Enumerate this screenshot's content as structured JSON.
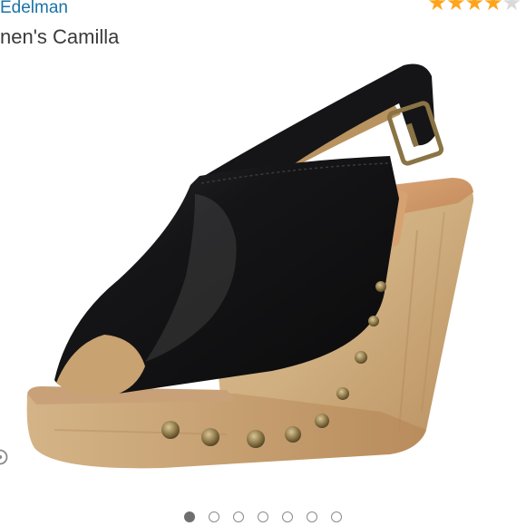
{
  "product": {
    "brand": "Edelman",
    "title": "nen's Camilla",
    "rating": 4,
    "rating_max": 5
  },
  "gallery": {
    "image_count": 7,
    "active_index": 0
  },
  "colors": {
    "link": "#1a73a8",
    "star": "#ffa41c",
    "star_empty": "#d9d9d9"
  },
  "icons": {
    "side": "share-icon"
  }
}
